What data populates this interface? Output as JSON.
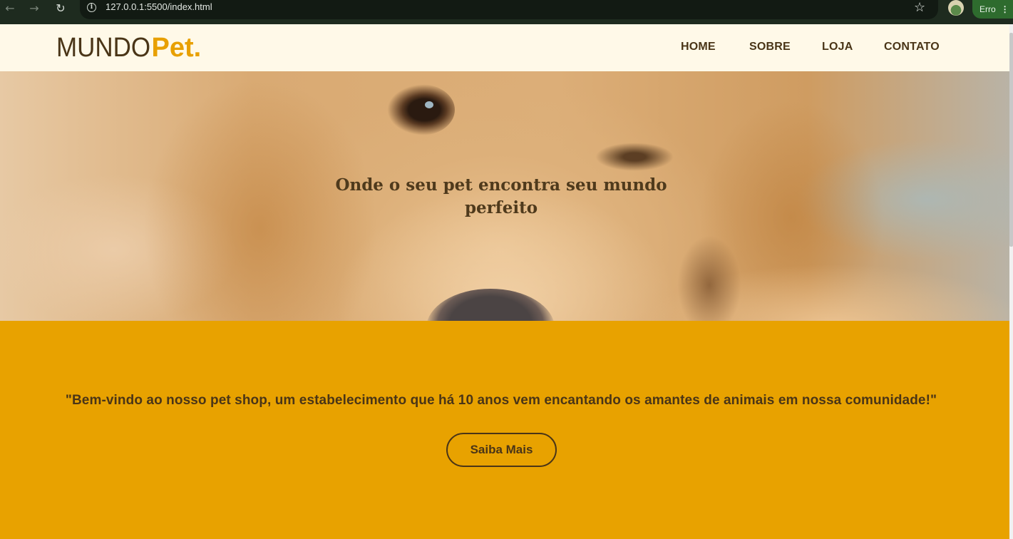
{
  "browser": {
    "url": "127.0.0.1:5500/index.html",
    "back_icon": "arrow-left-icon",
    "forward_icon": "arrow-right-icon",
    "reload_icon": "reload-icon",
    "site_info_icon": "info-icon",
    "bookmark_icon": "star-icon",
    "profile_icon": "avatar",
    "error_label": "Erro",
    "menu_icon": "kebab-menu-icon"
  },
  "header": {
    "logo_part1": "MUNDO",
    "logo_part2": "Pet.",
    "nav": [
      "HOME",
      "SOBRE",
      "LOJA",
      "CONTATO"
    ]
  },
  "hero": {
    "title_line1": "Onde o seu pet encontra seu mundo",
    "title_line2": "perfeito"
  },
  "welcome": {
    "text": "\"Bem-vindo ao nosso pet shop, um estabelecimento que há 10 anos vem encantando os amantes de animais em nossa comunidade!\"",
    "button_label": "Saiba Mais"
  },
  "colors": {
    "header_bg": "#fff9e8",
    "brand_brown": "#4a3517",
    "brand_gold": "#e8a200",
    "chrome_bg": "#1e2b1f"
  }
}
